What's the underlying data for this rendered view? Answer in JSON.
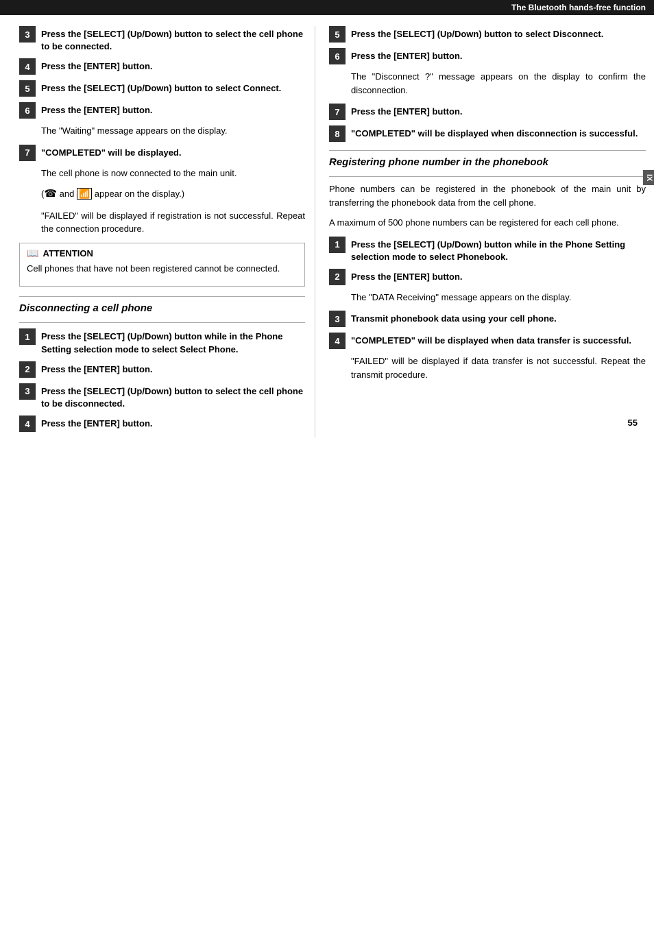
{
  "header": {
    "title": "The Bluetooth hands-free function"
  },
  "left_col": {
    "steps_connect": [
      {
        "num": "3",
        "text": "Press the [SELECT] (Up/Down) button to select the cell phone to be connected."
      },
      {
        "num": "4",
        "text": "Press the [ENTER] button."
      },
      {
        "num": "5",
        "text": "Press the [SELECT] (Up/Down) button to select Connect."
      },
      {
        "num": "6",
        "text": "Press the [ENTER] button."
      }
    ],
    "body1": "The \"Waiting\" message appears on the display.",
    "step7": {
      "num": "7",
      "text": "\"COMPLETED\" will be displayed."
    },
    "body2": "The cell phone is now connected to the main unit.",
    "body3": "(  and   appear on the display.)",
    "body4": "\"FAILED\" will be displayed if registration is not successful. Repeat the connection procedure.",
    "attention_title": "ATTENTION",
    "attention_text": "Cell phones that have not been registered cannot be connected.",
    "section_disconnect": "Disconnecting a cell phone",
    "steps_disconnect": [
      {
        "num": "1",
        "text": "Press the [SELECT] (Up/Down) button while in the Phone Setting selection mode to select Select Phone."
      },
      {
        "num": "2",
        "text": "Press the [ENTER] button."
      },
      {
        "num": "3",
        "text": "Press the [SELECT] (Up/Down) button to select the cell phone to be disconnected."
      },
      {
        "num": "4",
        "text": "Press the [ENTER] button."
      }
    ]
  },
  "right_col": {
    "steps_disconnect_cont": [
      {
        "num": "5",
        "text": "Press the [SELECT] (Up/Down) button to select Disconnect."
      },
      {
        "num": "6",
        "text": "Press the [ENTER] button."
      }
    ],
    "body_disconnect": "The \"Disconnect ?\" message appears on the display to confirm the disconnection.",
    "step7": {
      "num": "7",
      "text": "Press the [ENTER] button."
    },
    "step8": {
      "num": "8",
      "text": "\"COMPLETED\" will be displayed when disconnection is successful."
    },
    "section_phonebook": "Registering phone number in the phonebook",
    "body_phonebook1": "Phone numbers can be registered in the phonebook of the main unit by transferring the phonebook data from the cell phone.",
    "body_phonebook2": "A maximum of 500 phone numbers can be registered for each cell phone.",
    "steps_phonebook": [
      {
        "num": "1",
        "text": "Press the [SELECT] (Up/Down) button while in the Phone Setting selection mode to select Phonebook."
      },
      {
        "num": "2",
        "text": "Press the [ENTER] button."
      }
    ],
    "body_phonebook3": "The \"DATA Receiving\" message appears on the display.",
    "steps_phonebook2": [
      {
        "num": "3",
        "text": "Transmit phonebook data using your cell phone."
      },
      {
        "num": "4",
        "text": "\"COMPLETED\" will be displayed when data transfer is successful."
      }
    ],
    "body_phonebook4": "\"FAILED\" will be displayed if data transfer is not successful. Repeat the transmit procedure.",
    "side_tab": "IX",
    "page_number": "55"
  }
}
